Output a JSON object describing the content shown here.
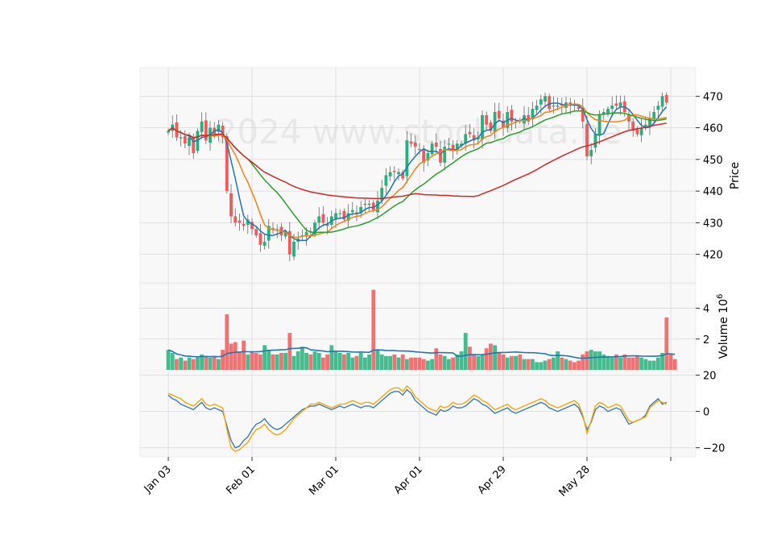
{
  "watermark": "2024 www.stockdata.ne",
  "chart_data": {
    "type": "candlestick",
    "panels": {
      "price": {
        "ylabel": "Price",
        "ticks": [
          420,
          430,
          440,
          450,
          460,
          470
        ],
        "ylim": [
          411,
          479
        ]
      },
      "volume": {
        "ylabel": "Volume  10",
        "ylabel_exp": "6",
        "ticks": [
          2,
          4
        ],
        "ylim": [
          0,
          5.6
        ]
      },
      "oscillator": {
        "ylabel": "",
        "ticks": [
          -20,
          0,
          20
        ],
        "tick_labels": [
          "−20",
          "0",
          "20"
        ],
        "ylim": [
          -25,
          22
        ]
      }
    },
    "x_tick_labels": [
      {
        "label": "Jan 03",
        "index": 0
      },
      {
        "label": "Feb 01",
        "index": 20
      },
      {
        "label": "Mar 01",
        "index": 40
      },
      {
        "label": "Apr 01",
        "index": 60
      },
      {
        "label": "Apr 29",
        "index": 80
      },
      {
        "label": "May 28",
        "index": 100
      },
      {
        "label": "",
        "index": 120
      }
    ],
    "grid": true,
    "colors": {
      "up": "#26b07b",
      "down": "#f05a5a",
      "ma1": "#1f77b4",
      "ma2": "#ff7f0e",
      "ma3": "#2ca02c",
      "ma4": "#d62728",
      "vol_ma": "#1f77b4",
      "osc1": "#3a7dbf",
      "osc2": "#ffa500",
      "panel_bg": "#f8f8f8",
      "grid": "#d9d9d9"
    },
    "closes": [
      459,
      461,
      457,
      457,
      455,
      457,
      452,
      459,
      462,
      456,
      460,
      458,
      461,
      457,
      440,
      432,
      430,
      430,
      429,
      431,
      428,
      426,
      423,
      424,
      429,
      428,
      428,
      426,
      427,
      420,
      424,
      425,
      426,
      427,
      427,
      430,
      432,
      430,
      429,
      432,
      433,
      433,
      431,
      433,
      434,
      433,
      435,
      436,
      436,
      434,
      437,
      441,
      445,
      446,
      446,
      446,
      444,
      456,
      455,
      454,
      453,
      449,
      452,
      455,
      454,
      449,
      454,
      455,
      453,
      455,
      455,
      458,
      458,
      456,
      457,
      464,
      461,
      459,
      465,
      463,
      460,
      465,
      462,
      462,
      462,
      464,
      462,
      466,
      467,
      469,
      470,
      466,
      467,
      467,
      467,
      468,
      467,
      467,
      466,
      462,
      451,
      453,
      458,
      464,
      465,
      466,
      467,
      467,
      468,
      465,
      462,
      459,
      458,
      460,
      461,
      463,
      465,
      467,
      470,
      468
    ],
    "volumes": [
      1.3,
      1.1,
      0.7,
      0.8,
      0.6,
      0.8,
      0.7,
      0.8,
      1.0,
      0.9,
      0.8,
      0.9,
      0.7,
      1.3,
      3.6,
      1.7,
      1.8,
      1.2,
      1.9,
      1.0,
      1.2,
      1.1,
      1.0,
      1.6,
      1.3,
      1.0,
      1.0,
      1.1,
      1.1,
      2.4,
      0.9,
      1.2,
      1.5,
      1.1,
      1.0,
      1.2,
      1.1,
      0.8,
      1.0,
      1.6,
      1.2,
      1.1,
      1.0,
      1.1,
      0.8,
      0.9,
      1.1,
      0.8,
      1.0,
      5.2,
      1.3,
      1.0,
      0.9,
      0.9,
      1.0,
      0.8,
      1.0,
      0.7,
      0.8,
      0.8,
      0.8,
      0.7,
      0.6,
      0.7,
      1.4,
      1.0,
      0.9,
      0.7,
      0.8,
      1.0,
      1.2,
      2.4,
      1.5,
      1.0,
      0.9,
      1.0,
      1.4,
      1.7,
      1.6,
      1.1,
      1.0,
      0.8,
      0.9,
      0.9,
      1.0,
      0.7,
      0.7,
      0.7,
      0.5,
      0.5,
      0.6,
      0.7,
      0.8,
      1.2,
      0.8,
      0.7,
      0.6,
      0.5,
      0.6,
      1.0,
      1.2,
      1.3,
      1.2,
      1.2,
      1.0,
      0.9,
      0.8,
      1.0,
      0.8,
      1.0,
      0.8,
      0.8,
      0.9,
      0.8,
      0.7,
      0.6,
      0.6,
      0.8,
      1.1,
      3.4,
      1.0,
      0.7
    ],
    "oscillator_series": [
      {
        "values": [
          9,
          7,
          6,
          4,
          3,
          2,
          1,
          3,
          5,
          2,
          1,
          2,
          1,
          0,
          -8,
          -16,
          -20,
          -19,
          -16,
          -14,
          -10,
          -7,
          -6,
          -4,
          -7,
          -9,
          -10,
          -9,
          -7,
          -5,
          -3,
          -1,
          1,
          2,
          3,
          3,
          4,
          3,
          2,
          1,
          2,
          3,
          2,
          3,
          4,
          3,
          2,
          3,
          3,
          2,
          4,
          6,
          8,
          10,
          11,
          11,
          9,
          12,
          10,
          6,
          4,
          2,
          0,
          -1,
          -2,
          1,
          0,
          1,
          3,
          2,
          2,
          3,
          5,
          7,
          6,
          4,
          3,
          1,
          -1,
          0,
          1,
          2,
          0,
          -1,
          0,
          1,
          2,
          3,
          4,
          5,
          4,
          2,
          1,
          0,
          1,
          2,
          3,
          4,
          2,
          -3,
          -10,
          -6,
          1,
          3,
          2,
          0,
          1,
          2,
          1,
          -3,
          -7,
          -6,
          -5,
          -4,
          -2,
          3,
          5,
          7,
          4,
          5
        ],
        "color": "#3a7dbf"
      },
      {
        "values": [
          10,
          9,
          8,
          7,
          5,
          4,
          3,
          5,
          7,
          4,
          3,
          4,
          3,
          2,
          -10,
          -20,
          -22,
          -21,
          -19,
          -17,
          -13,
          -10,
          -9,
          -7,
          -10,
          -12,
          -13,
          -12,
          -10,
          -7,
          -4,
          -2,
          0,
          2,
          4,
          4,
          5,
          4,
          3,
          2,
          3,
          4,
          4,
          5,
          6,
          5,
          4,
          5,
          5,
          4,
          6,
          8,
          10,
          12,
          13,
          13,
          11,
          14,
          12,
          8,
          6,
          4,
          2,
          1,
          0,
          3,
          2,
          3,
          5,
          4,
          4,
          5,
          7,
          9,
          8,
          6,
          5,
          3,
          1,
          2,
          3,
          4,
          2,
          1,
          2,
          3,
          4,
          5,
          6,
          7,
          6,
          4,
          3,
          2,
          3,
          4,
          5,
          6,
          4,
          -2,
          -12,
          -5,
          3,
          5,
          4,
          2,
          3,
          4,
          3,
          -1,
          -5,
          -6,
          -5,
          -4,
          -3,
          2,
          4,
          6,
          5,
          4
        ],
        "color": "#ffa500"
      }
    ]
  }
}
